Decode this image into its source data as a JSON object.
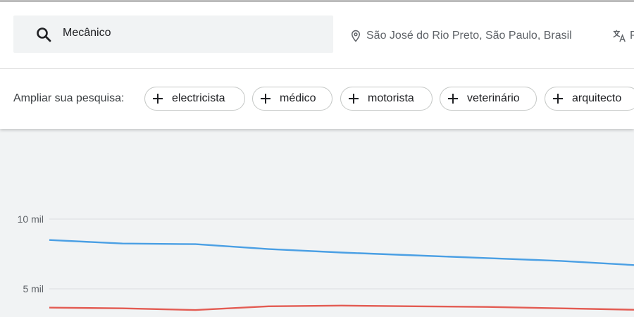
{
  "search": {
    "query": "Mecânico"
  },
  "location": {
    "text": "São José do Rio Preto, São Paulo, Brasil"
  },
  "language": {
    "text": "P"
  },
  "expand": {
    "label": "Ampliar sua pesquisa:",
    "chips": [
      {
        "label": "electricista"
      },
      {
        "label": "médico"
      },
      {
        "label": "motorista"
      },
      {
        "label": "veterinário"
      },
      {
        "label": "arquitecto"
      }
    ]
  },
  "colors": {
    "series_blue": "#4a9fe4",
    "series_red": "#e35b52"
  },
  "chart_data": {
    "type": "line",
    "y_ticks": [
      {
        "value": 10000,
        "label": "10 mil"
      },
      {
        "value": 5000,
        "label": "5 mil"
      }
    ],
    "ylim": [
      3500,
      12000
    ],
    "x": [
      0,
      1,
      2,
      3,
      4,
      5,
      6,
      7,
      8
    ],
    "series": [
      {
        "color": "#4a9fe4",
        "values": [
          8500,
          8250,
          8200,
          7850,
          7600,
          7400,
          7200,
          7000,
          6700
        ]
      },
      {
        "color": "#e35b52",
        "values": [
          3650,
          3600,
          3480,
          3750,
          3800,
          3750,
          3700,
          3600,
          3500
        ]
      }
    ]
  }
}
